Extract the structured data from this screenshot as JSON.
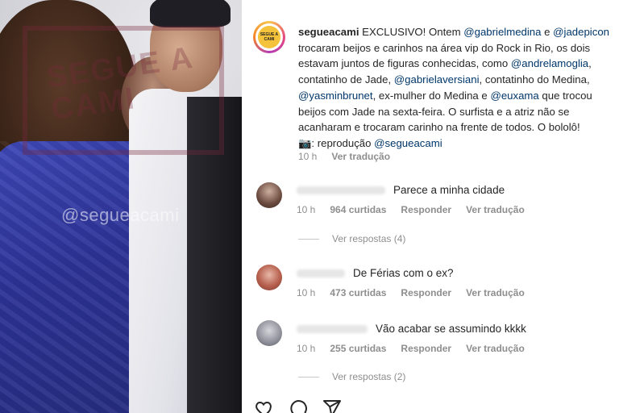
{
  "photo": {
    "watermark": "@segueacami",
    "logo_text": "SEGUE A CAMI"
  },
  "post": {
    "username": "segueacami",
    "avatar_text": "SEGUE A CAMI",
    "caption_lines": [
      {
        "pre": " EXCLUSIVO! Ontem ",
        "m1": "@gabrielmedina",
        "mid": " e ",
        "m2": "@jadepicon"
      },
      {
        "text": "trocaram beijos e carinhos na área vip do Rock in Rio, os dois"
      },
      {
        "pre": "estavam juntos de figuras conhecidas, como ",
        "m1": "@andrelamoglia",
        "post": ","
      },
      {
        "pre": "contatinho de Jade, ",
        "m1": "@gabrielaversiani",
        "post": ", contatinho do Medina,"
      },
      {
        "m1": "@yasminbrunet",
        "mid": ", ex-mulher do Medina e ",
        "m2": "@euxama",
        "post": " que trocou"
      },
      {
        "text": "beijos com Jade na sexta-feira. O surfista e a atriz não se"
      },
      {
        "text": "acanharam e trocaram carinho na frente de todos. O bololô!"
      },
      {
        "pre": "📷: reprodução ",
        "m1": "@segueacami"
      }
    ],
    "time": "10 h",
    "translate": "Ver tradução"
  },
  "comments": [
    {
      "text": "Parece a minha cidade",
      "time": "10 h",
      "likes": "964 curtidas",
      "reply": "Responder",
      "translate": "Ver tradução",
      "replies": "Ver respostas (4)"
    },
    {
      "text": "De Férias com o ex?",
      "time": "10 h",
      "likes": "473 curtidas",
      "reply": "Responder",
      "translate": "Ver tradução"
    },
    {
      "text": "Vão acabar se assumindo kkkk",
      "time": "10 h",
      "likes": "255 curtidas",
      "reply": "Responder",
      "translate": "Ver tradução",
      "replies": "Ver respostas (2)"
    }
  ],
  "icons": [
    "heart-icon",
    "comment-icon",
    "share-icon"
  ],
  "colors": {
    "mention": "#00376b",
    "meta": "#8e8e8e",
    "text": "#262626",
    "avatar_logo": "#f4c23b"
  }
}
